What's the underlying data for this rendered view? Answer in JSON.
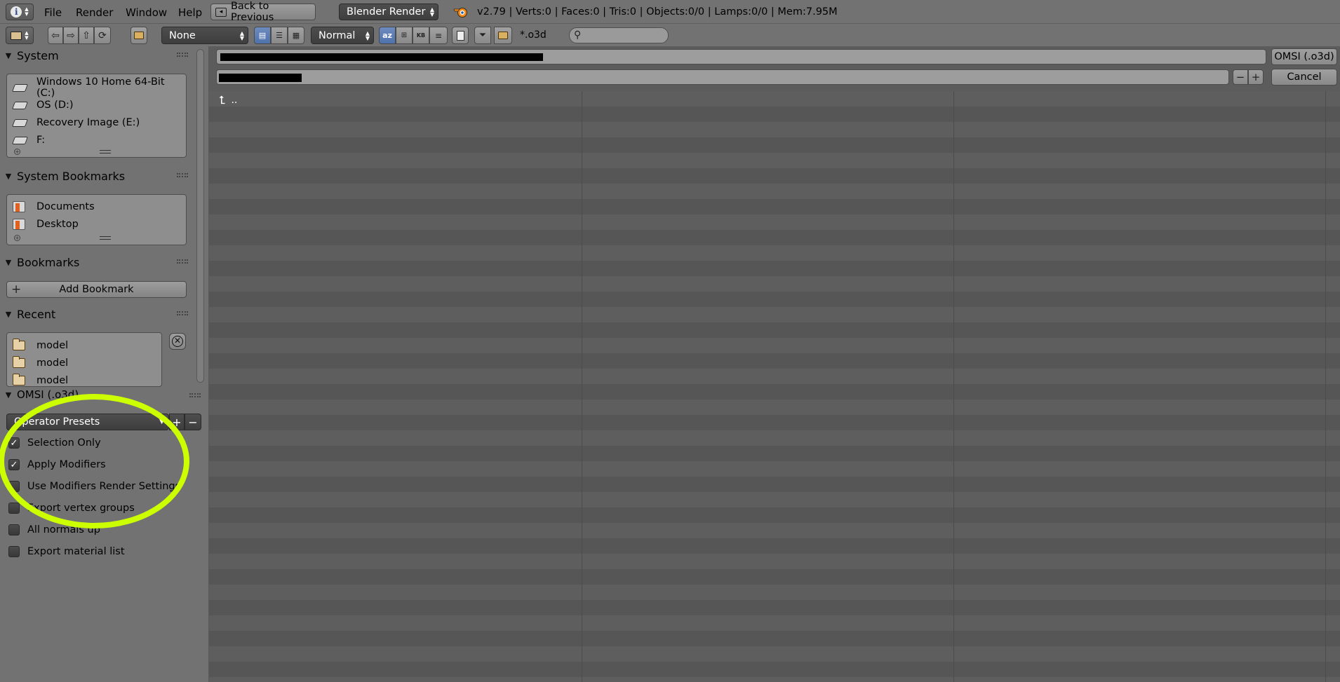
{
  "topbar": {
    "menus": [
      "File",
      "Render",
      "Window",
      "Help"
    ],
    "back_label": "Back to Previous",
    "engine_label": "Blender Render",
    "stats": "v2.79 | Verts:0 | Faces:0 | Tris:0 | Objects:0/0 | Lamps:0/0 | Mem:7.95M"
  },
  "toolbar": {
    "recursion": "None",
    "display_size": "Normal",
    "filter_glob": "*.o3d"
  },
  "sidebar": {
    "system": {
      "title": "System",
      "items": [
        "Windows 10 Home 64-Bit  (C:)",
        "OS (D:)",
        "Recovery Image (E:)",
        "F:"
      ]
    },
    "system_bookmarks": {
      "title": "System Bookmarks",
      "items": [
        "Documents",
        "Desktop"
      ]
    },
    "bookmarks": {
      "title": "Bookmarks",
      "add_label": "Add Bookmark"
    },
    "recent": {
      "title": "Recent",
      "items": [
        "model",
        "model",
        "model"
      ]
    },
    "operator": {
      "title": "OMSI (.o3d)",
      "presets_label": "Operator Presets",
      "options": [
        {
          "label": "Selection Only",
          "checked": true
        },
        {
          "label": "Apply Modifiers",
          "checked": true
        },
        {
          "label": "Use Modifiers Render Settings",
          "checked": false
        },
        {
          "label": "Export vertex groups",
          "checked": false
        },
        {
          "label": "All normals up",
          "checked": false
        },
        {
          "label": "Export material list",
          "checked": false
        }
      ]
    }
  },
  "main": {
    "export_label": "OMSI (.o3d)",
    "cancel_label": "Cancel",
    "parent_dir": ".."
  },
  "colors": {
    "highlight_circle": "#ccff00",
    "active_button": "#5577b0"
  }
}
